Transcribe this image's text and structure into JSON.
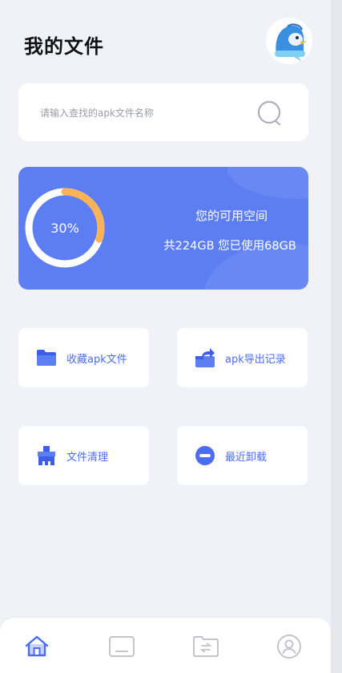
{
  "header": {
    "title": "我的文件",
    "avatar_icon": "penguin-avatar-icon"
  },
  "search": {
    "placeholder": "请输入查找的apk文件名称",
    "icon": "search-icon"
  },
  "storage": {
    "percent_label": "30%",
    "used_fraction": 0.3,
    "title": "您的可用空间",
    "usage_text": "共224GB 您已使用68GB",
    "card_color": "#5c7ef2",
    "progress_color": "#ffb356"
  },
  "tiles": [
    {
      "label": "收藏apk文件",
      "icon": "folder-icon"
    },
    {
      "label": "apk导出记录",
      "icon": "export-icon"
    },
    {
      "label": "文件清理",
      "icon": "broom-icon"
    },
    {
      "label": "最近卸载",
      "icon": "minus-circle-icon"
    }
  ],
  "bottom_nav": [
    {
      "icon": "home-icon",
      "active": true
    },
    {
      "icon": "tablet-icon",
      "active": false
    },
    {
      "icon": "transfer-folder-icon",
      "active": false
    },
    {
      "icon": "profile-icon",
      "active": false
    }
  ],
  "colors": {
    "accent": "#4b6cf0",
    "background": "#f1f2f8"
  }
}
